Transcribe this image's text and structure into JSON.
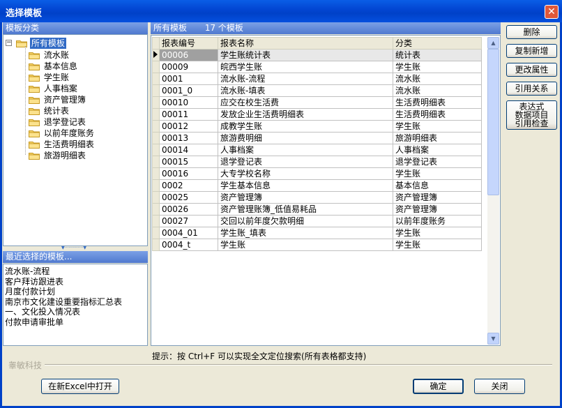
{
  "window": {
    "title": "选择模板",
    "close_glyph": "✕"
  },
  "left_panel": {
    "header": "模板分类",
    "tree": {
      "expander": "−",
      "root": "所有模板",
      "children": [
        "流水账",
        "基本信息",
        "学生账",
        "人事档案",
        "资产管理簿",
        "统计表",
        "退学登记表",
        "以前年度账务",
        "生活费明细表",
        "旅游明细表"
      ]
    },
    "splitter": "▼··············▼"
  },
  "recent_panel": {
    "header": "最近选择的模板...",
    "items": [
      "流水账-流程",
      "客户拜访跟进表",
      "月度付款计划",
      "南京市文化建设重要指标汇总表",
      "一、文化投入情况表",
      "付款申请审批单"
    ]
  },
  "main_panel": {
    "header": "所有模板",
    "count": "17 个模板",
    "columns": [
      "报表编号",
      "报表名称",
      "分类"
    ],
    "rows": [
      [
        "00006",
        "学生账统计表",
        "统计表"
      ],
      [
        "00009",
        "皖西学生账",
        "学生账"
      ],
      [
        "0001",
        "流水账-流程",
        "流水账"
      ],
      [
        "0001_0",
        "流水账-填表",
        "流水账"
      ],
      [
        "00010",
        "应交在校生活费",
        "生活费明细表"
      ],
      [
        "00011",
        "发放企业生活费明细表",
        "生活费明细表"
      ],
      [
        "00012",
        "成教学生账",
        "学生账"
      ],
      [
        "00013",
        "旅游费明细",
        "旅游明细表"
      ],
      [
        "00014",
        "人事档案",
        "人事档案"
      ],
      [
        "00015",
        "退学登记表",
        "退学登记表"
      ],
      [
        "00016",
        "大专学校名称",
        "学生账"
      ],
      [
        "0002",
        "学生基本信息",
        "基本信息"
      ],
      [
        "00025",
        "资产管理簿",
        "资产管理簿"
      ],
      [
        "00026",
        "资产管理账簿_低值易耗品",
        "资产管理簿"
      ],
      [
        "00027",
        "交回以前年度欠款明细",
        "以前年度账务"
      ],
      [
        "0004_01",
        "学生账_填表",
        "学生账"
      ],
      [
        "0004_t",
        "学生账",
        "学生账"
      ]
    ],
    "selected_row": 0
  },
  "side_buttons": {
    "delete": "删除",
    "copy_new": "复制新增",
    "change_props": "更改属性",
    "references": "引用关系",
    "expr_line1": "表达式",
    "expr_line2": "数据项目",
    "expr_line3": "引用检查"
  },
  "hint": "提示：按 Ctrl+F 可以实现全文定位搜索(所有表格都支持)",
  "brand": "睾敏科技",
  "footer_buttons": {
    "open_excel": "在新Excel中打开",
    "ok": "确定",
    "close": "关闭"
  },
  "colors": {
    "title_bar": "#0347d3",
    "panel_header": "#6b91de",
    "selection": "#316ac5"
  }
}
